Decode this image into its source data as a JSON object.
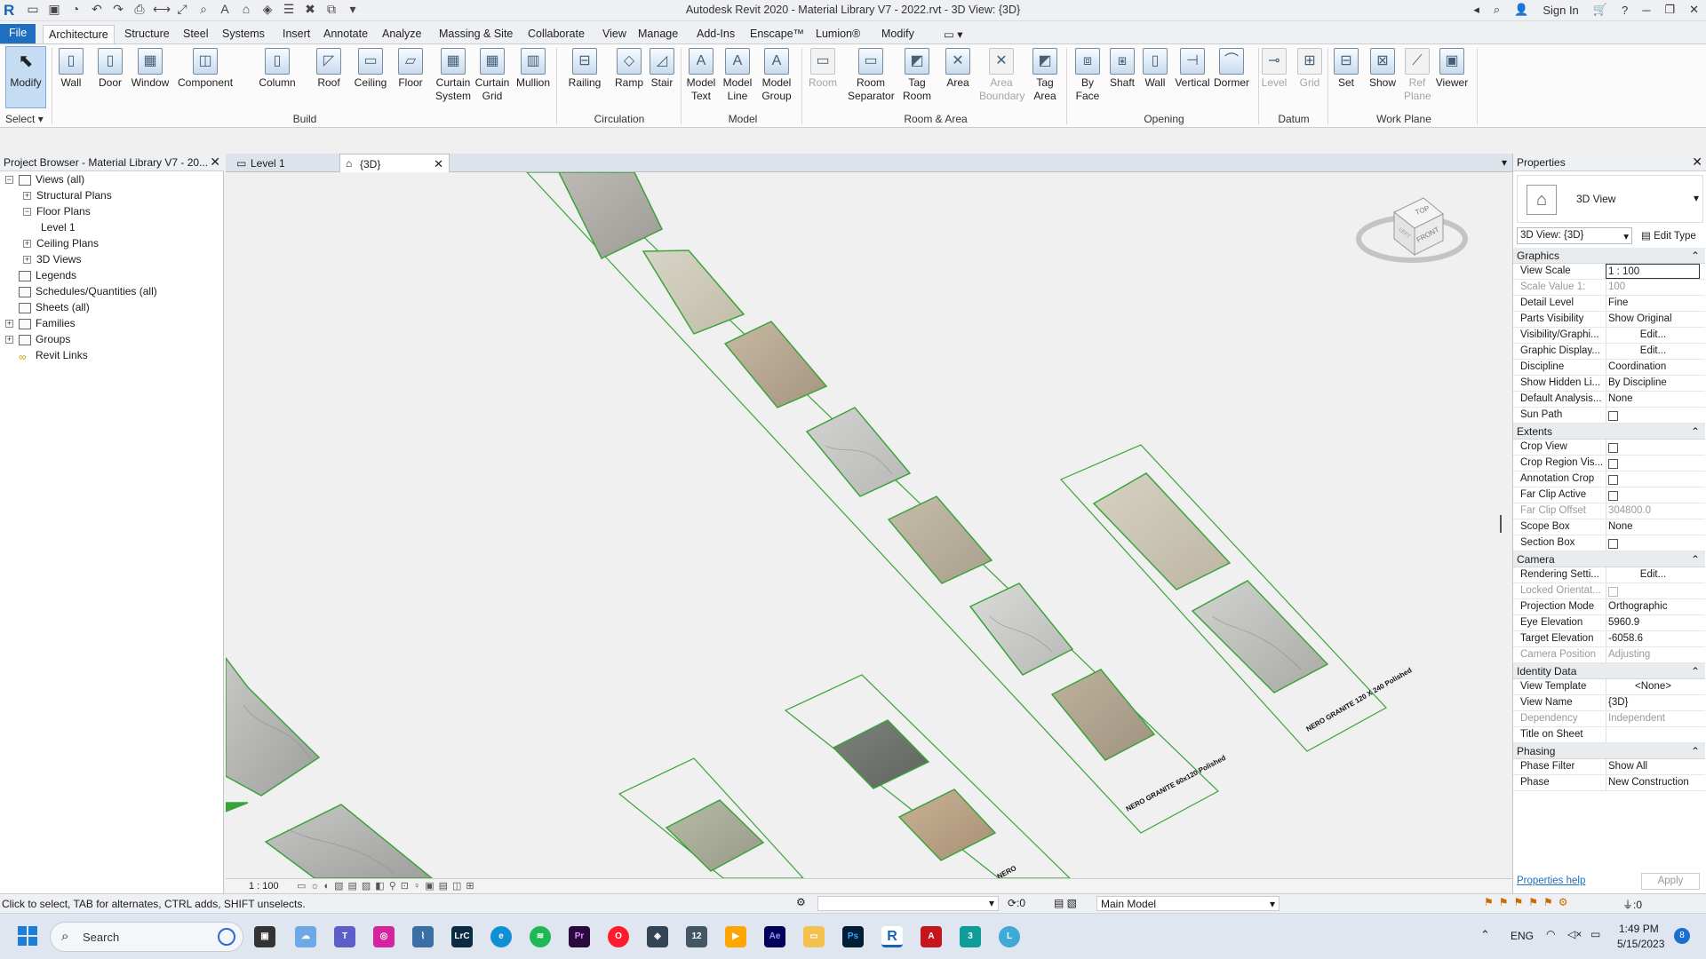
{
  "window": {
    "title": "Autodesk Revit 2020 - Material Library V7 - 2022.rvt - 3D View: {3D}",
    "sign_in": "Sign In"
  },
  "menu_tabs": [
    "File",
    "Architecture",
    "Structure",
    "Steel",
    "Systems",
    "Insert",
    "Annotate",
    "Analyze",
    "Massing & Site",
    "Collaborate",
    "View",
    "Manage",
    "Add-Ins",
    "Enscape™",
    "Lumion®",
    "Modify"
  ],
  "ribbon": {
    "modify": "Modify",
    "select_label": "Select",
    "build": [
      {
        "l1": "Wall",
        "l2": ""
      },
      {
        "l1": "Door",
        "l2": ""
      },
      {
        "l1": "Window",
        "l2": ""
      },
      {
        "l1": "Component",
        "l2": ""
      },
      {
        "l1": "Column",
        "l2": ""
      },
      {
        "l1": "Roof",
        "l2": ""
      },
      {
        "l1": "Ceiling",
        "l2": ""
      },
      {
        "l1": "Floor",
        "l2": ""
      },
      {
        "l1": "Curtain",
        "l2": "System"
      },
      {
        "l1": "Curtain",
        "l2": "Grid"
      },
      {
        "l1": "Mullion",
        "l2": ""
      }
    ],
    "circulation": [
      {
        "l1": "Railing",
        "l2": ""
      },
      {
        "l1": "Ramp",
        "l2": ""
      },
      {
        "l1": "Stair",
        "l2": ""
      }
    ],
    "model": [
      {
        "l1": "Model",
        "l2": "Text"
      },
      {
        "l1": "Model",
        "l2": "Line"
      },
      {
        "l1": "Model",
        "l2": "Group"
      }
    ],
    "room_area": [
      {
        "l1": "Room",
        "l2": "",
        "disabled": true
      },
      {
        "l1": "Room",
        "l2": "Separator"
      },
      {
        "l1": "Tag",
        "l2": "Room"
      },
      {
        "l1": "Area",
        "l2": ""
      },
      {
        "l1": "Area",
        "l2": "Boundary",
        "disabled": true
      },
      {
        "l1": "Tag",
        "l2": "Area"
      }
    ],
    "opening": [
      {
        "l1": "By",
        "l2": "Face"
      },
      {
        "l1": "Shaft",
        "l2": ""
      },
      {
        "l1": "Wall",
        "l2": ""
      },
      {
        "l1": "Vertical",
        "l2": ""
      },
      {
        "l1": "Dormer",
        "l2": ""
      }
    ],
    "datum": [
      {
        "l1": "Level",
        "l2": "",
        "disabled": true
      },
      {
        "l1": "Grid",
        "l2": "",
        "disabled": true
      }
    ],
    "workplane": [
      {
        "l1": "Set",
        "l2": ""
      },
      {
        "l1": "Show",
        "l2": ""
      },
      {
        "l1": "Ref",
        "l2": "Plane",
        "disabled": true
      },
      {
        "l1": "Viewer",
        "l2": ""
      }
    ],
    "panels": {
      "build": "Build",
      "circulation": "Circulation",
      "model": "Model",
      "room_area": "Room & Area",
      "opening": "Opening",
      "datum": "Datum",
      "workplane": "Work Plane"
    }
  },
  "project_browser": {
    "title": "Project Browser - Material Library V7 - 20...",
    "items": [
      {
        "label": "Views (all)",
        "indent": 0,
        "exp": "-"
      },
      {
        "label": "Structural Plans",
        "indent": 1,
        "exp": "+"
      },
      {
        "label": "Floor Plans",
        "indent": 1,
        "exp": "-"
      },
      {
        "label": "Level 1",
        "indent": 2,
        "exp": ""
      },
      {
        "label": "Ceiling Plans",
        "indent": 1,
        "exp": "+"
      },
      {
        "label": "3D Views",
        "indent": 1,
        "exp": "+"
      },
      {
        "label": "Legends",
        "indent": 0,
        "exp": ""
      },
      {
        "label": "Schedules/Quantities (all)",
        "indent": 0,
        "exp": ""
      },
      {
        "label": "Sheets (all)",
        "indent": 0,
        "exp": ""
      },
      {
        "label": "Families",
        "indent": 0,
        "exp": "+"
      },
      {
        "label": "Groups",
        "indent": 0,
        "exp": "+"
      },
      {
        "label": "Revit Links",
        "indent": 0,
        "exp": ""
      }
    ]
  },
  "view_tabs": [
    {
      "label": "Level 1",
      "active": false
    },
    {
      "label": "{3D}",
      "active": true
    }
  ],
  "canvas": {
    "tag1": "NERO GRANITE 60x120 Polished",
    "tag2": "NERO GRANITE 120 X 240 Polished",
    "viewcube_top": "TOP",
    "viewcube_front": "FRONT",
    "viewcube_left": "LEFT"
  },
  "view_control": {
    "scale": "1 : 100"
  },
  "properties": {
    "title": "Properties",
    "type_name": "3D View",
    "selector": "3D View: {3D}",
    "edit_type": "Edit Type",
    "groups": [
      {
        "name": "Graphics",
        "rows": [
          {
            "k": "View Scale",
            "v": "1 : 100"
          },
          {
            "k": "Scale Value 1:",
            "v": "100",
            "dim": true
          },
          {
            "k": "Detail Level",
            "v": "Fine"
          },
          {
            "k": "Parts Visibility",
            "v": "Show Original"
          },
          {
            "k": "Visibility/Graphi...",
            "v": "Edit...",
            "btn": true
          },
          {
            "k": "Graphic Display...",
            "v": "Edit...",
            "btn": true
          },
          {
            "k": "Discipline",
            "v": "Coordination"
          },
          {
            "k": "Show Hidden Li...",
            "v": "By Discipline"
          },
          {
            "k": "Default Analysis...",
            "v": "None"
          },
          {
            "k": "Sun Path",
            "v": "",
            "cb": true
          }
        ]
      },
      {
        "name": "Extents",
        "rows": [
          {
            "k": "Crop View",
            "v": "",
            "cb": true
          },
          {
            "k": "Crop Region Vis...",
            "v": "",
            "cb": true
          },
          {
            "k": "Annotation Crop",
            "v": "",
            "cb": true
          },
          {
            "k": "Far Clip Active",
            "v": "",
            "cb": true
          },
          {
            "k": "Far Clip Offset",
            "v": "304800.0",
            "dim": true
          },
          {
            "k": "Scope Box",
            "v": "None"
          },
          {
            "k": "Section Box",
            "v": "",
            "cb": true
          }
        ]
      },
      {
        "name": "Camera",
        "rows": [
          {
            "k": "Rendering Setti...",
            "v": "Edit...",
            "btn": true
          },
          {
            "k": "Locked Orientat...",
            "v": "",
            "cb": true,
            "dim": true
          },
          {
            "k": "Projection Mode",
            "v": "Orthographic"
          },
          {
            "k": "Eye Elevation",
            "v": "5960.9"
          },
          {
            "k": "Target Elevation",
            "v": "-6058.6"
          },
          {
            "k": "Camera Position",
            "v": "Adjusting",
            "dim": true
          }
        ]
      },
      {
        "name": "Identity Data",
        "rows": [
          {
            "k": "View Template",
            "v": "<None>",
            "btn": true
          },
          {
            "k": "View Name",
            "v": "{3D}"
          },
          {
            "k": "Dependency",
            "v": "Independent",
            "dim": true
          },
          {
            "k": "Title on Sheet",
            "v": ""
          }
        ]
      },
      {
        "name": "Phasing",
        "rows": [
          {
            "k": "Phase Filter",
            "v": "Show All"
          },
          {
            "k": "Phase",
            "v": "New Construction"
          }
        ]
      }
    ],
    "help": "Properties help",
    "apply": "Apply"
  },
  "status": {
    "hint": "Click to select, TAB for alternates, CTRL adds, SHIFT unselects.",
    "zero": ":0",
    "model": "Main Model",
    "filter": ":0"
  },
  "taskbar": {
    "search": "Search",
    "lang": "ENG",
    "time": "1:49 PM",
    "date": "5/15/2023",
    "badge": "8"
  }
}
